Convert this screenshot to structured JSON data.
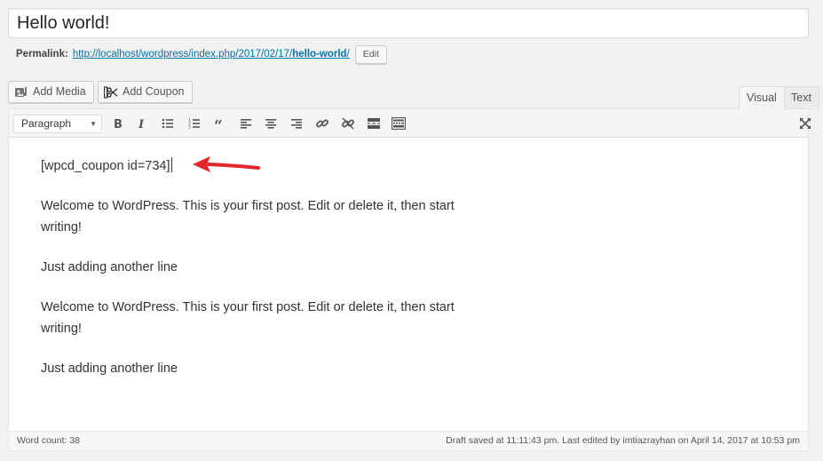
{
  "post": {
    "title": "Hello world!"
  },
  "permalink": {
    "label": "Permalink:",
    "url_base": "http://localhost/wordpress/index.php/2017/02/17/",
    "slug": "hello-world",
    "url_tail": "/",
    "edit_label": "Edit"
  },
  "media_buttons": {
    "add_media": "Add Media",
    "add_coupon": "Add Coupon"
  },
  "tabs": {
    "visual": "Visual",
    "text": "Text"
  },
  "toolbar": {
    "format_selected": "Paragraph",
    "icons": [
      "bold-icon",
      "italic-icon",
      "bullet-list-icon",
      "numbered-list-icon",
      "blockquote-icon",
      "align-left-icon",
      "align-center-icon",
      "align-right-icon",
      "insert-link-icon",
      "remove-link-icon",
      "read-more-icon",
      "toolbar-toggle-icon",
      "fullscreen-icon"
    ]
  },
  "content": {
    "shortcode": "[wpcd_coupon id=734]",
    "para1": "Welcome to WordPress. This is your first post. Edit or delete it, then start writing!",
    "para2": "Just adding another line",
    "para3": "Welcome to WordPress. This is your first post. Edit or delete it, then start writing!",
    "para4": "Just adding another line"
  },
  "status": {
    "word_count": "Word count: 38",
    "draft": "Draft saved at 11:11:43 pm. Last edited by imtiazrayhan on April 14, 2017 at 10:53 pm"
  },
  "colors": {
    "link": "#0073aa",
    "annotation_arrow": "#e3262a"
  }
}
